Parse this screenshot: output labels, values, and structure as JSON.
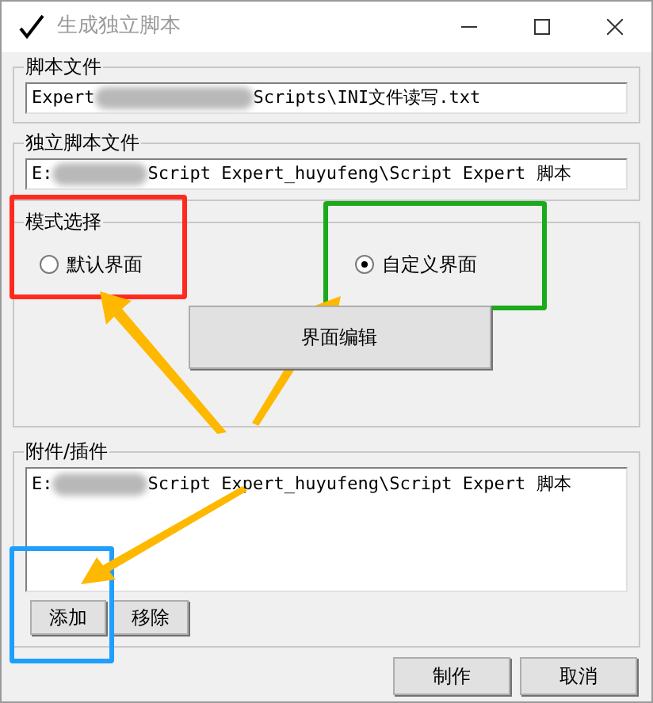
{
  "window": {
    "title": "生成独立脚本"
  },
  "script_file": {
    "label": "脚本文件",
    "value_start": "Expert",
    "value_end": "Scripts\\INI文件读写.txt"
  },
  "standalone_file": {
    "label": "独立脚本文件",
    "value_start": "E:",
    "value_end": "Script Expert_huyufeng\\Script Expert 脚本"
  },
  "mode": {
    "label": "模式选择",
    "options": [
      {
        "label": "默认界面",
        "selected": false
      },
      {
        "label": "自定义界面",
        "selected": true
      }
    ],
    "edit_button": "界面编辑"
  },
  "attachments": {
    "label": "附件/插件",
    "items": [
      {
        "start": "E:",
        "end": "Script Expert_huyufeng\\Script Expert 脚本"
      }
    ],
    "buttons": [
      "添加",
      "移除"
    ]
  },
  "buttons": [
    "制作",
    "取消"
  ],
  "annotations": [
    {
      "color": "#ff2a1f"
    },
    {
      "color": "#1aaa1a"
    },
    {
      "color": "#1e9fff"
    }
  ]
}
